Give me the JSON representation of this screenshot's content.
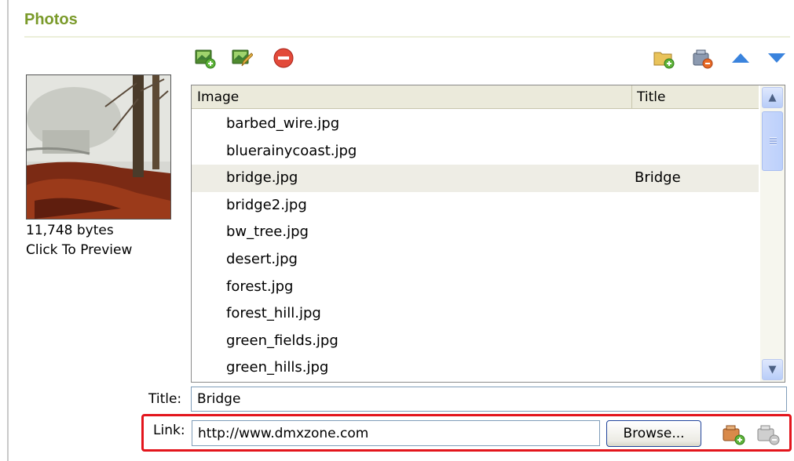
{
  "section": {
    "title": "Photos"
  },
  "toolbar": {
    "left_icons": [
      "add-image-icon",
      "edit-image-icon",
      "remove-icon"
    ],
    "right_icons": [
      "add-folder-icon",
      "remove-folder-icon",
      "move-up-icon",
      "move-down-icon"
    ]
  },
  "preview": {
    "bytes": "11,748 bytes",
    "hint": "Click To Preview"
  },
  "list": {
    "columns": [
      "Image",
      "Title"
    ],
    "rows": [
      {
        "image": "barbed_wire.jpg",
        "title": ""
      },
      {
        "image": "bluerainycoast.jpg",
        "title": ""
      },
      {
        "image": "bridge.jpg",
        "title": "Bridge",
        "selected": true
      },
      {
        "image": "bridge2.jpg",
        "title": ""
      },
      {
        "image": "bw_tree.jpg",
        "title": ""
      },
      {
        "image": "desert.jpg",
        "title": ""
      },
      {
        "image": "forest.jpg",
        "title": ""
      },
      {
        "image": "forest_hill.jpg",
        "title": ""
      },
      {
        "image": "green_fields.jpg",
        "title": ""
      },
      {
        "image": "green_hills.jpg",
        "title": ""
      }
    ]
  },
  "form": {
    "title_label": "Title:",
    "title_value": "Bridge",
    "link_label": "Link:",
    "link_value": "http://www.dmxzone.com",
    "browse_label": "Browse..."
  },
  "colors": {
    "section_title": "#7a9a2a",
    "highlight_frame": "#e3151c",
    "selected_row": "#eeede5"
  }
}
